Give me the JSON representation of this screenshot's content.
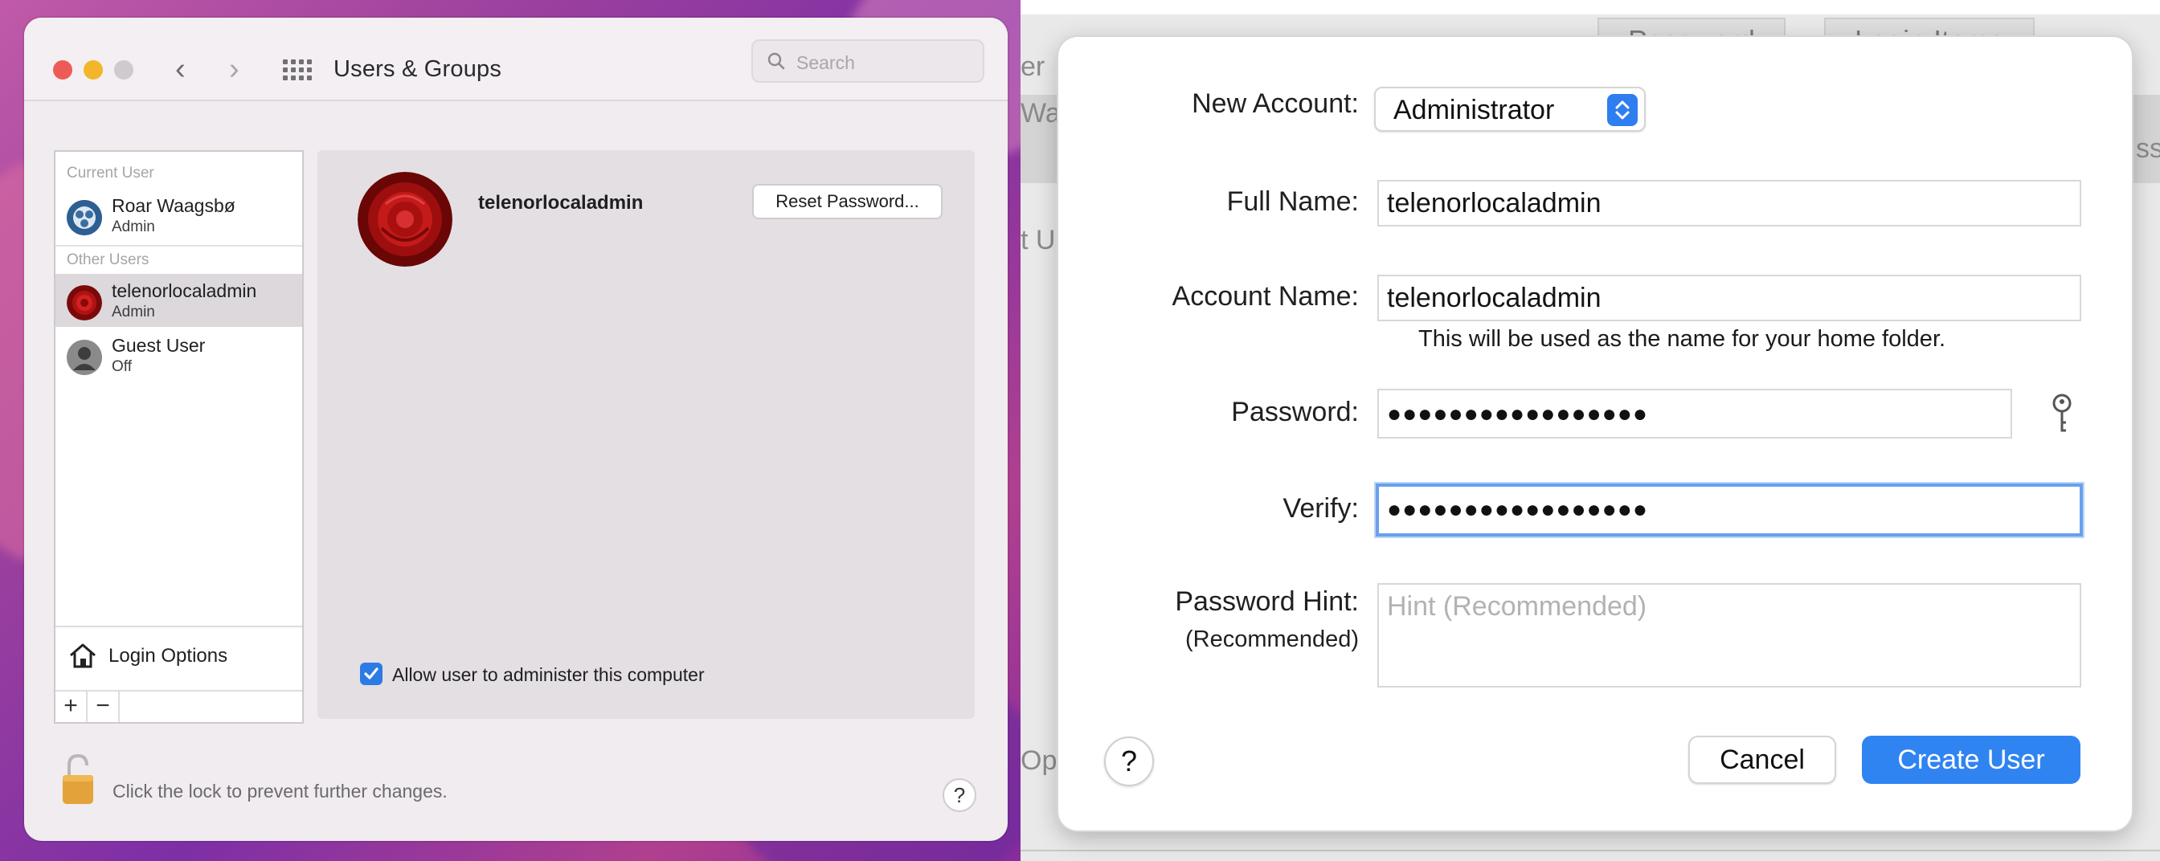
{
  "left_window": {
    "title": "Users & Groups",
    "search": {
      "placeholder": "Search"
    },
    "sidebar": {
      "current_user_header": "Current User",
      "other_users_header": "Other Users",
      "current_user": {
        "name": "Roar Waagsbø",
        "role": "Admin"
      },
      "other_users": [
        {
          "name": "telenorlocaladmin",
          "role": "Admin",
          "selected": true
        },
        {
          "name": "Guest User",
          "role": "Off",
          "selected": false
        }
      ],
      "login_options_label": "Login Options",
      "add_label": "+",
      "remove_label": "−"
    },
    "detail": {
      "user_name": "telenorlocaladmin",
      "reset_password_label": "Reset Password...",
      "allow_admin_label": "Allow user to administer this computer",
      "allow_admin_checked": true
    },
    "lock_text": "Click the lock to prevent further changes.",
    "help_label": "?"
  },
  "background_window": {
    "tabs": [
      "Password",
      "Login Items"
    ],
    "fragments": [
      "er",
      "Wa",
      "t U",
      "Op",
      "ss"
    ]
  },
  "new_user_sheet": {
    "new_account_label": "New Account:",
    "new_account_value": "Administrator",
    "full_name_label": "Full Name:",
    "full_name_value": "telenorlocaladmin",
    "account_name_label": "Account Name:",
    "account_name_value": "telenorlocaladmin",
    "account_name_note": "This will be used as the name for your home folder.",
    "password_label": "Password:",
    "password_value": "●●●●●●●●●●●●●●●●●",
    "verify_label": "Verify:",
    "verify_value": "●●●●●●●●●●●●●●●●●",
    "hint_label": "Password Hint:",
    "hint_sublabel": "(Recommended)",
    "hint_placeholder": "Hint (Recommended)",
    "help_label": "?",
    "cancel_label": "Cancel",
    "create_label": "Create User"
  },
  "colors": {
    "accent": "#2f84f2",
    "selection": "#dcd8dc",
    "wallpaper": "#9a3f9e"
  }
}
